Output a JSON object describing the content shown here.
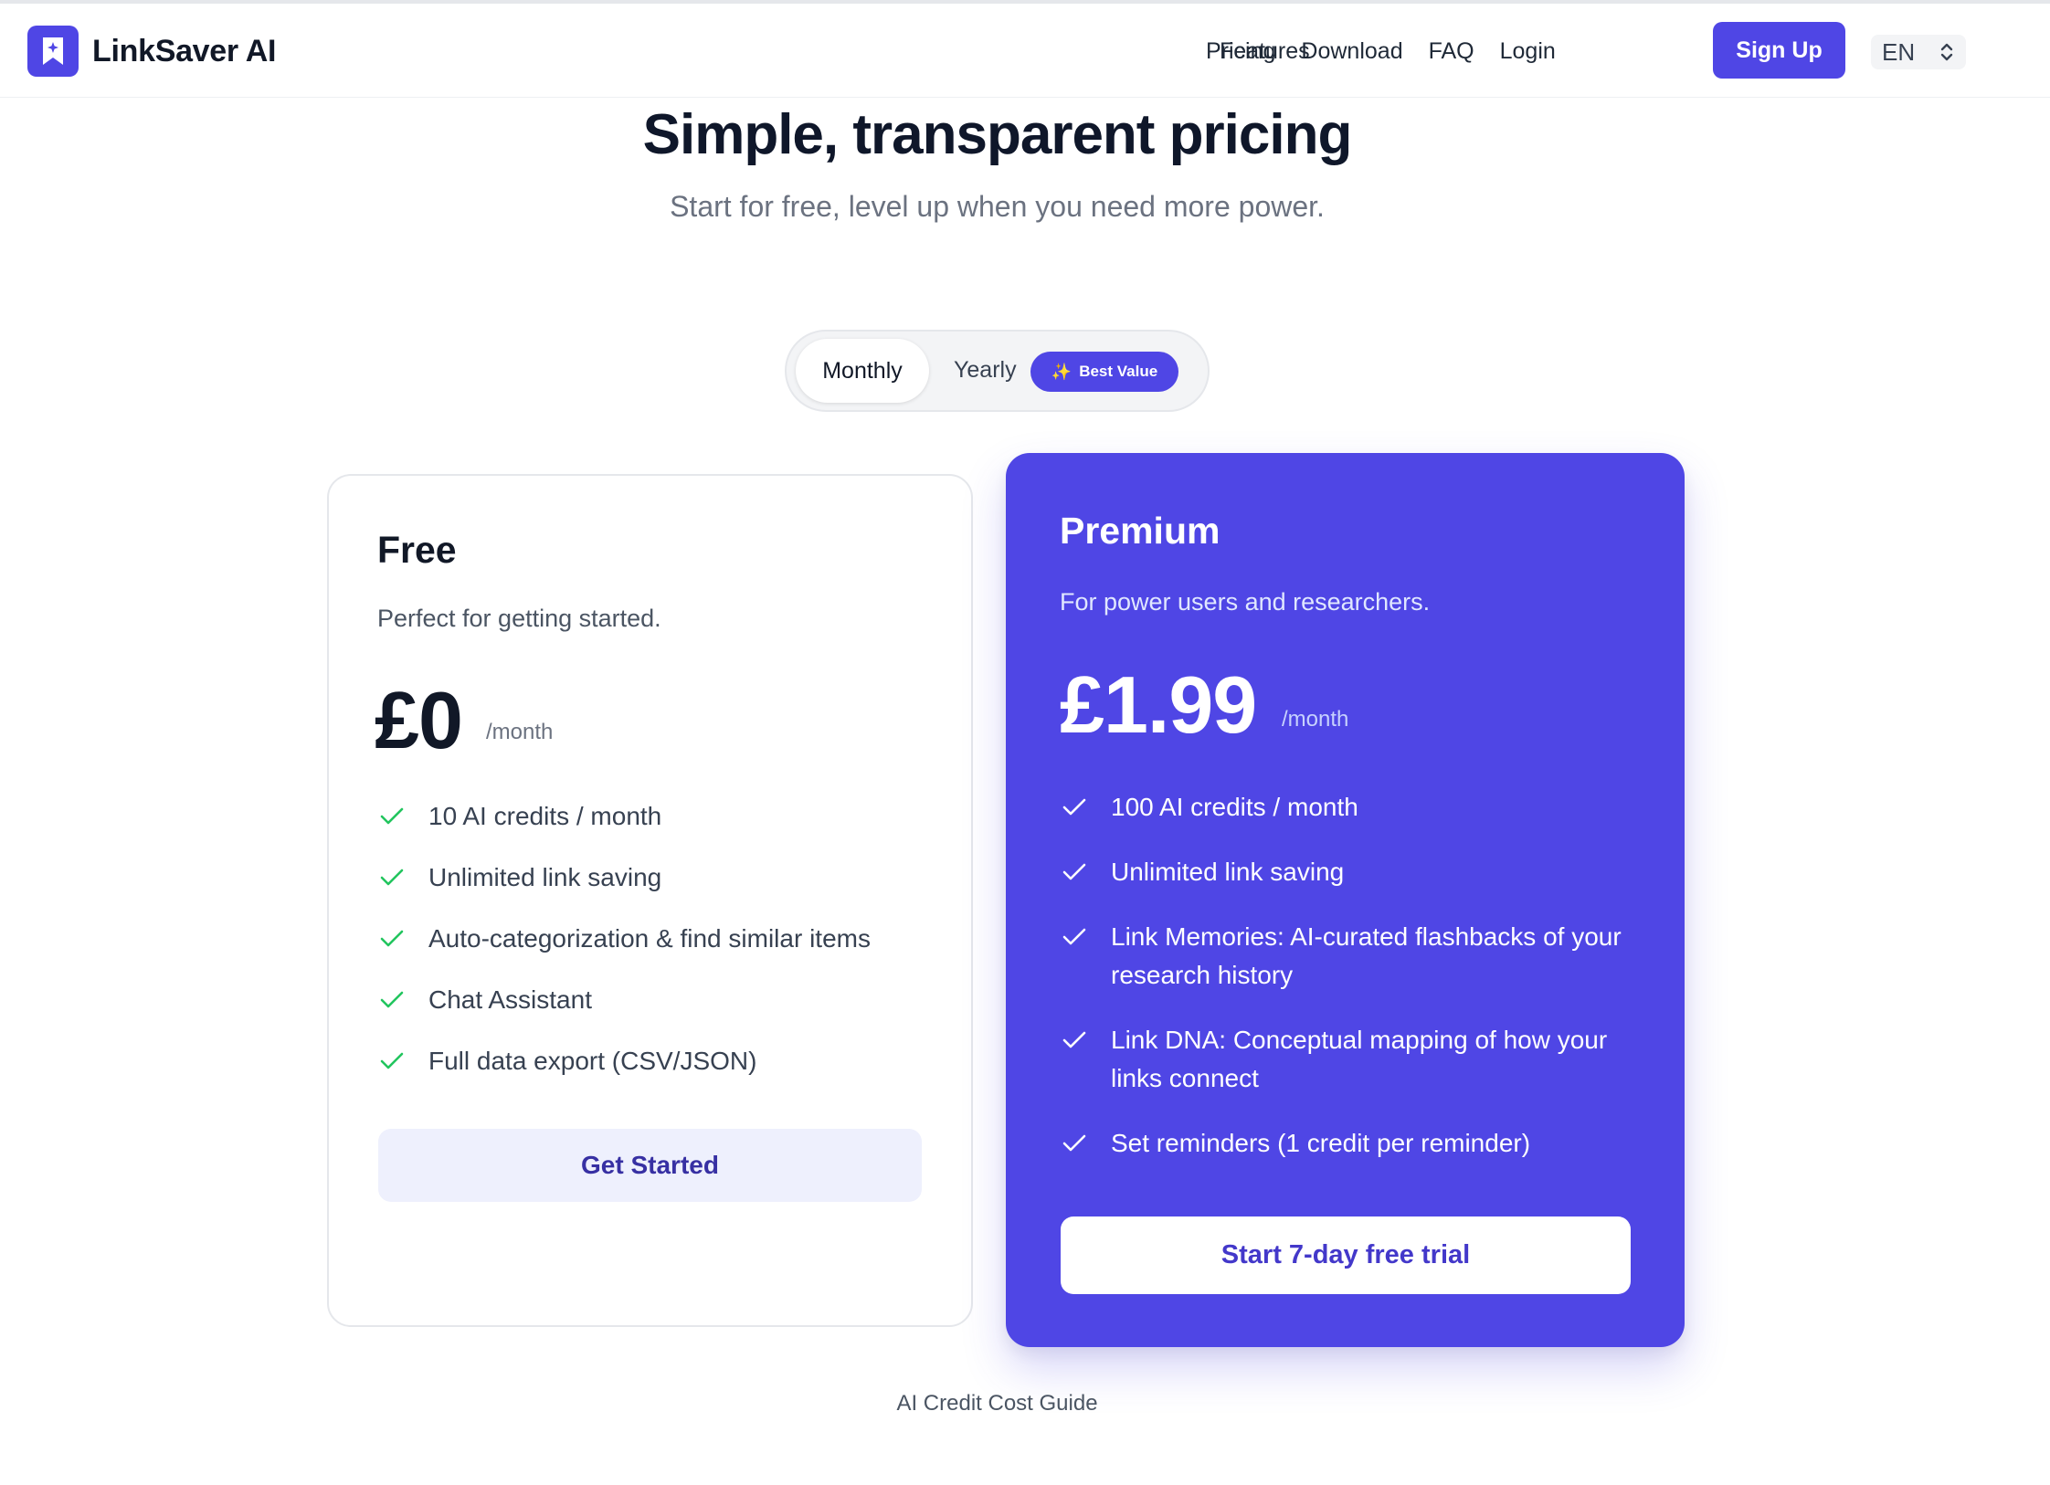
{
  "nav": {
    "brand": "LinkSaver AI",
    "links": [
      "Features",
      "Pricing",
      "Download",
      "FAQ",
      "Login"
    ],
    "signup_label": "Sign Up",
    "language": "EN"
  },
  "hero": {
    "title": "Simple, transparent pricing",
    "subtitle": "Start for free, level up when you need more power."
  },
  "billing_toggle": {
    "monthly_label": "Monthly",
    "yearly_label": "Yearly",
    "badge_label": "Best Value",
    "selected": "Monthly"
  },
  "plans": {
    "free": {
      "name": "Free",
      "description": "Perfect for getting started.",
      "price": "£0",
      "period": "/month",
      "features": [
        "10 AI credits / month",
        "Unlimited link saving",
        "Auto-categorization & find similar items",
        "Chat Assistant",
        "Full data export (CSV/JSON)"
      ],
      "cta": "Get Started"
    },
    "premium": {
      "name": "Premium",
      "description": "For power users and researchers.",
      "price": "£1.99",
      "period": "/month",
      "features": [
        "100 AI credits / month",
        "Unlimited link saving",
        "Link Memories: AI-curated flashbacks of your research history",
        "Link DNA: Conceptual mapping of how your links connect",
        "Set reminders (1 credit per reminder)"
      ],
      "cta": "Start 7-day free trial"
    }
  },
  "footer": {
    "credit_guide": "AI Credit Cost Guide"
  },
  "colors": {
    "accent": "#4f46e5",
    "check_free": "#22c55e",
    "check_premium": "#ffffff"
  }
}
